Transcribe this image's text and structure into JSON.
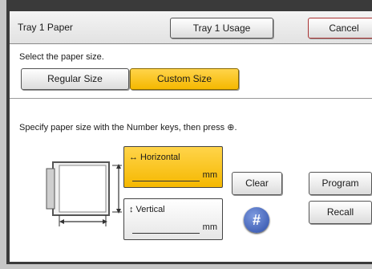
{
  "header": {
    "title": "Tray 1 Paper",
    "usage_label": "Tray 1 Usage",
    "cancel_label": "Cancel"
  },
  "paper_size": {
    "prompt": "Select the paper size.",
    "options": [
      {
        "label": "Regular Size",
        "selected": false
      },
      {
        "label": "Custom Size",
        "selected": true
      }
    ]
  },
  "instructions": "Specify paper size with the Number keys, then press ⊕.",
  "fields": {
    "horizontal": {
      "label": "↔ Horizontal",
      "value": "",
      "unit": "mm",
      "active": true
    },
    "vertical": {
      "label": "↕ Vertical",
      "value": "",
      "unit": "mm",
      "active": false
    }
  },
  "buttons": {
    "clear": "Clear",
    "program": "Program",
    "recall": "Recall",
    "hash_key": "#"
  },
  "colors": {
    "selected": "#f5b800",
    "hash_key": "#2d4ea8",
    "panel": "#ffffff"
  }
}
